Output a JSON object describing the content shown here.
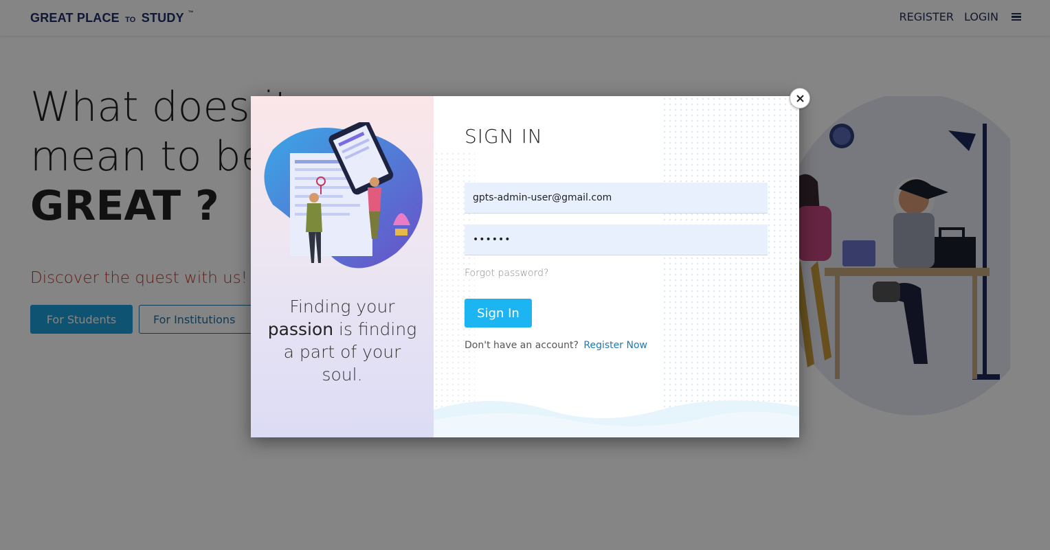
{
  "header": {
    "logo_main": "GREAT PLACE",
    "logo_to": "TO",
    "logo_end": "STUDY",
    "logo_tm": "™",
    "register_label": "REGISTER",
    "login_label": "LOGIN",
    "menu_icon": "hamburger-icon"
  },
  "hero": {
    "title_line1": "What does it",
    "title_line2": "mean to be",
    "title_line3": "GREAT ?",
    "tagline": "Discover the quest with us!",
    "students_button": "For Students",
    "institutions_button": "For Institutions"
  },
  "modal": {
    "quote_line1": "Finding your",
    "quote_strong": "passion",
    "quote_rest": " is finding",
    "quote_line3": "a part of your",
    "quote_line4": "soul.",
    "title": "SIGN IN",
    "email_value": "gpts-admin-user@gmail.com",
    "password_value": "••••••",
    "forgot_label": "Forgot password?",
    "signin_button": "Sign In",
    "no_account_text": "Don't have an account?",
    "register_now_link": "Register Now",
    "close_icon": "close-icon"
  },
  "colors": {
    "brand_navy": "#1f2f6b",
    "primary_blue": "#1ea0da",
    "signin_blue": "#1cb5f1",
    "link_blue": "#1f78b4",
    "tagline_red": "#c0392b",
    "input_bg": "#e8f0fe"
  }
}
